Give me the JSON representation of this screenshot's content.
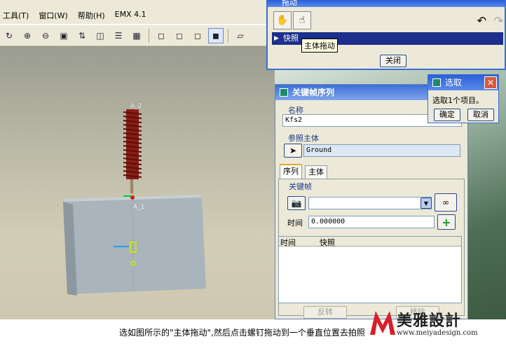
{
  "menubar": {
    "items": [
      "工具(T)",
      "窗口(W)",
      "帮助(H)",
      "EMX 4.1"
    ]
  },
  "drag_dialog": {
    "title": "拖动",
    "snapshot_label": "快照",
    "tooltip": "主体拖动",
    "close_label": "关闭"
  },
  "keyframe_dialog": {
    "title": "关键帧序列",
    "name_label": "名称",
    "name_value": "Kfs2",
    "ref_body_label": "参照主体",
    "ref_body_value": "Ground",
    "tabs": [
      "序列",
      "主体"
    ],
    "keyframe_label": "关键帧",
    "time_label": "时间",
    "time_value": "0.000000",
    "list_headers": [
      "时间",
      "快照"
    ],
    "reverse_label": "反转",
    "remove_label": "移除"
  },
  "select_dialog": {
    "title": "选取",
    "message": "选取1个项目。",
    "ok_label": "确定",
    "cancel_label": "取消"
  },
  "viewport": {
    "label_a2": "A_2",
    "label_a1": "A_1"
  },
  "caption": "选如图所示的\"主体拖动\",然后点击螺钉拖动到一个垂直位置去拍照",
  "logo": {
    "name": "美雅設計",
    "url": "www.meiyadesign.com"
  },
  "colors": {
    "title_blue": "#2a5fd8",
    "snapshot_bar": "#1c2f8a",
    "screw": "#8a1e14",
    "block": "#a9b4bc"
  }
}
